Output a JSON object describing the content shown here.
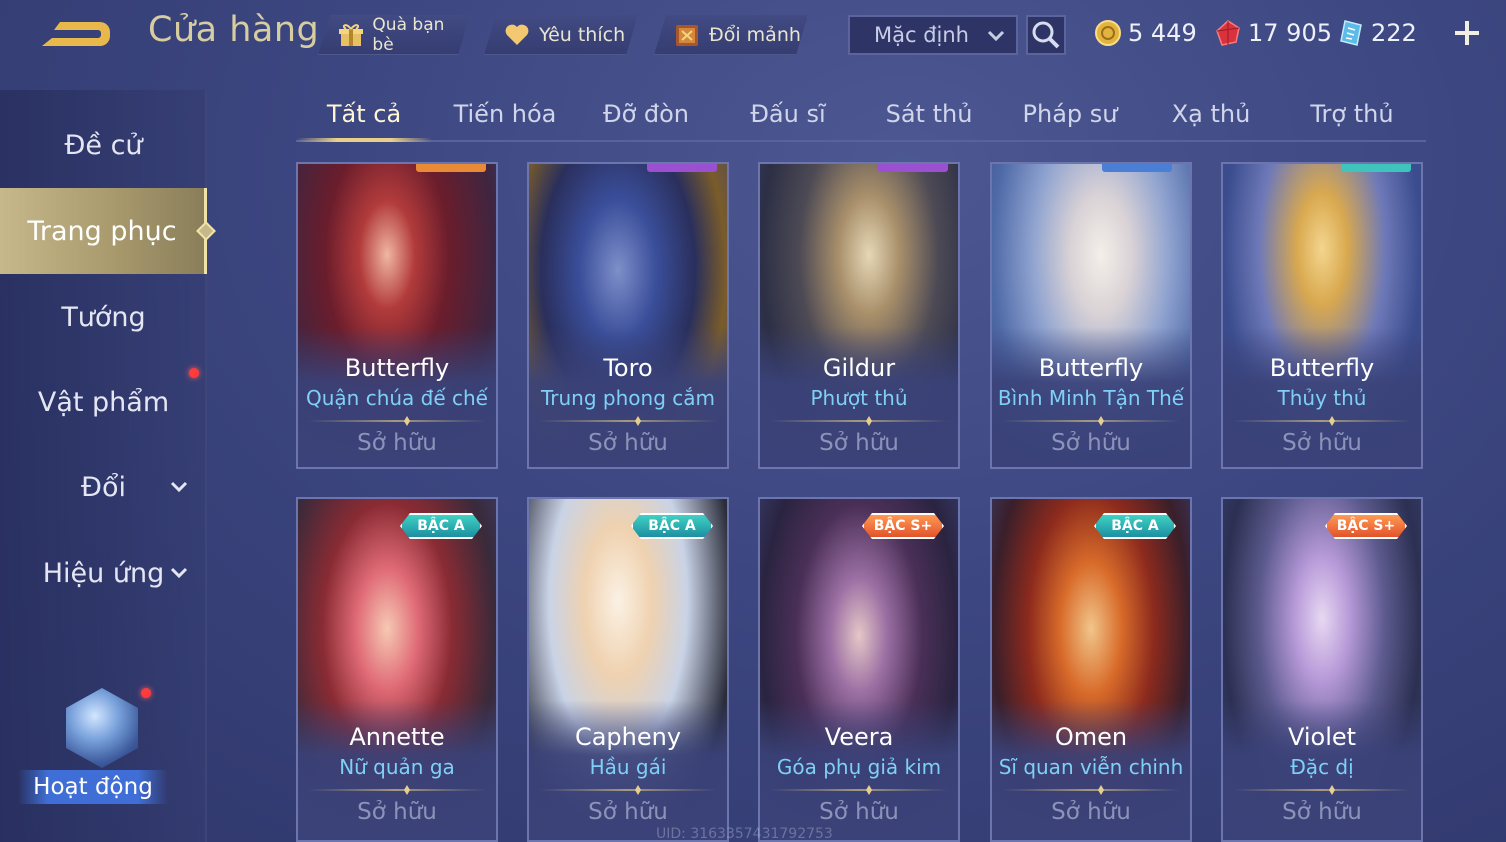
{
  "header": {
    "title": "Cửa hàng",
    "gift_label": "Quà bạn bè",
    "favorite_label": "Yêu thích",
    "fragment_label": "Đổi mảnh",
    "sort_value": "Mặc định",
    "currency": {
      "gold": "5 449",
      "ruby": "17 905",
      "voucher": "222"
    }
  },
  "sidebar": {
    "items": [
      {
        "label": "Đề cử"
      },
      {
        "label": "Trang phục"
      },
      {
        "label": "Tướng"
      },
      {
        "label": "Vật phẩm"
      },
      {
        "label": "Đổi"
      },
      {
        "label": "Hiệu ứng"
      }
    ],
    "event_label": "Hoạt động"
  },
  "tabs": [
    "Tất cả",
    "Tiến hóa",
    "Đỡ đòn",
    "Đấu sĩ",
    "Sát thủ",
    "Pháp sư",
    "Xạ thủ",
    "Trợ thủ"
  ],
  "cards": [
    {
      "hero": "Butterfly",
      "skin": "Quận chúa đế chế",
      "status": "Sở hữu",
      "tier": ""
    },
    {
      "hero": "Toro",
      "skin": "Trung phong cắm",
      "status": "Sở hữu",
      "tier": ""
    },
    {
      "hero": "Gildur",
      "skin": "Phượt thủ",
      "status": "Sở hữu",
      "tier": ""
    },
    {
      "hero": "Butterfly",
      "skin": "Bình Minh Tận Thế",
      "status": "Sở hữu",
      "tier": ""
    },
    {
      "hero": "Butterfly",
      "skin": "Thủy thủ",
      "status": "Sở hữu",
      "tier": ""
    },
    {
      "hero": "Annette",
      "skin": "Nữ quản ga",
      "status": "Sở hữu",
      "tier": "BẬC A"
    },
    {
      "hero": "Capheny",
      "skin": "Hầu gái",
      "status": "Sở hữu",
      "tier": "BẬC A"
    },
    {
      "hero": "Veera",
      "skin": "Góa phụ giả kim",
      "status": "Sở hữu",
      "tier": "BẬC S+"
    },
    {
      "hero": "Omen",
      "skin": "Sĩ quan viễn chinh",
      "status": "Sở hữu",
      "tier": "BẬC A"
    },
    {
      "hero": "Violet",
      "skin": "Đặc dị",
      "status": "Sở hữu",
      "tier": "BẬC S+"
    }
  ],
  "uid_text": "UID: 3163357431792753",
  "colors": {
    "background": "#3c4680",
    "active_gold": "#c6b88a",
    "skin_name": "#7fd0f7",
    "tier_a": "#2bb3b3",
    "tier_splus": "#ef6a3a",
    "notify_red": "#ff3b3b"
  },
  "icons": {
    "back": "back-arrow-icon",
    "gift": "gift-icon",
    "favorite": "heart-icon",
    "fragment": "fragment-chest-icon",
    "search": "search-icon",
    "gold": "gold-coin-icon",
    "ruby": "ruby-gem-icon",
    "voucher": "voucher-icon",
    "add": "plus-icon"
  }
}
